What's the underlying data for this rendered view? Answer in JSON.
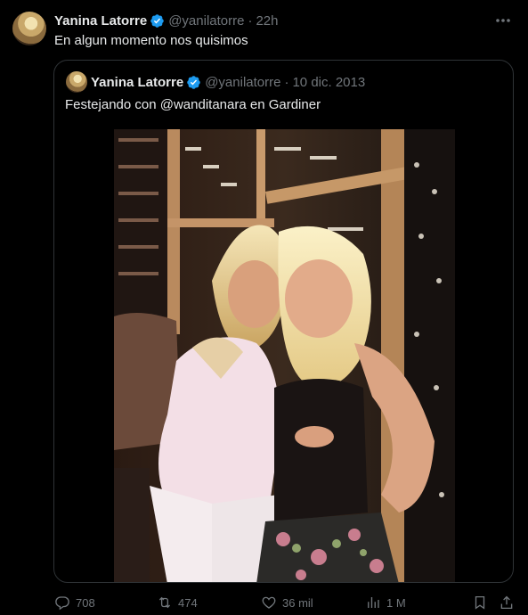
{
  "tweet": {
    "author_name": "Yanina Latorre",
    "handle": "@yanilatorre",
    "separator": "·",
    "time": "22h",
    "text": "En algun momento nos quisimos"
  },
  "quoted": {
    "author_name": "Yanina Latorre",
    "handle": "@yanilatorre",
    "separator": "·",
    "date": "10 dic. 2013",
    "text": "Festejando con @wanditanara en Gardiner"
  },
  "actions": {
    "replies": "708",
    "reposts": "474",
    "likes": "36 mil",
    "views": "1 M"
  },
  "icons": {
    "verified": "verified-badge-icon",
    "more": "more-options-icon",
    "reply": "reply-icon",
    "repost": "repost-icon",
    "like": "heart-icon",
    "views": "views-chart-icon",
    "bookmark": "bookmark-icon",
    "share": "share-icon"
  },
  "colors": {
    "background": "#000000",
    "text": "#e7e9ea",
    "muted": "#71767b",
    "verified": "#1d9bf0",
    "border": "#2f3336"
  }
}
